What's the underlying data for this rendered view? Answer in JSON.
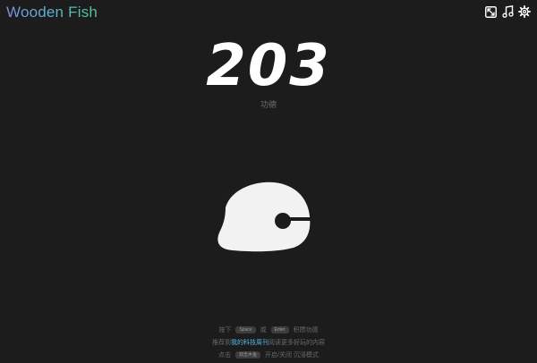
{
  "app": {
    "title": "Wooden Fish"
  },
  "toolbar": {
    "fullscreen_icon": "fullscreen-icon",
    "music_icon": "music-note-icon",
    "settings_icon": "gear-icon"
  },
  "counter": {
    "value": "203",
    "label": "功德"
  },
  "fish": {
    "icon": "wooden-fish-icon",
    "color": "#f2f2f2"
  },
  "hints": {
    "line1": {
      "prefix": "按下",
      "key1": "Space",
      "middle": "或",
      "key2": "Enter",
      "suffix": "积攒功德"
    },
    "line2": {
      "prefix": "推荐到",
      "link": "我的科技周刊",
      "suffix": "阅读更多好玩的内容"
    },
    "line3": {
      "prefix": "点击",
      "key": "双击木鱼",
      "suffix": "开启/关闭 沉浸模式"
    }
  },
  "colors": {
    "background": "#1c1c1c",
    "link": "#56b8e6",
    "title_gradient_start": "#7a8ee0",
    "title_gradient_end": "#53c78f"
  }
}
